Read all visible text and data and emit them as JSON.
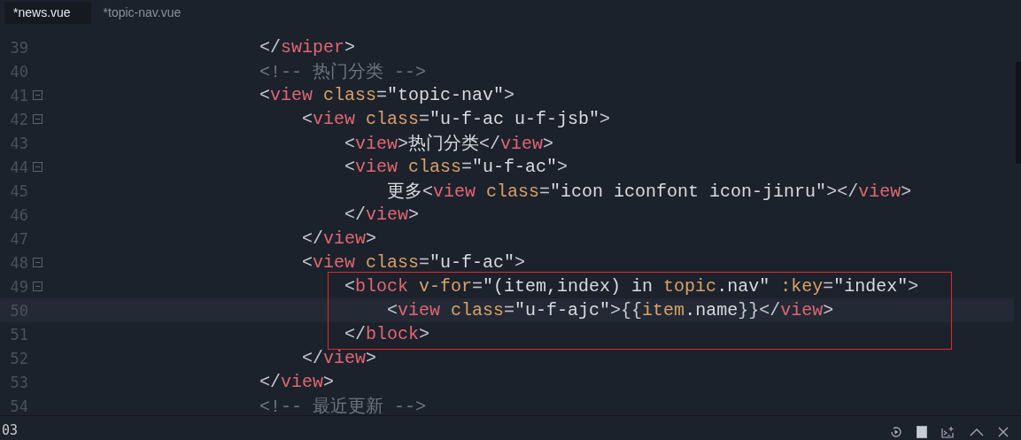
{
  "tabs": [
    {
      "label": "*news.vue",
      "selected": true
    },
    {
      "label": "*topic-nav.vue",
      "selected": false
    }
  ],
  "lines": [
    {
      "number": "39",
      "foldable": false,
      "current": false,
      "marked": false,
      "tokens": [
        {
          "kind": "punct",
          "text": "</"
        },
        {
          "kind": "tag",
          "text": "swiper"
        },
        {
          "kind": "punct",
          "text": ">"
        }
      ]
    },
    {
      "number": "40",
      "foldable": false,
      "current": false,
      "marked": false,
      "tokens": [
        {
          "kind": "comment",
          "text": "<!-- 热门分类 -->"
        }
      ]
    },
    {
      "number": "41",
      "foldable": true,
      "current": false,
      "marked": false,
      "tokens": [
        {
          "kind": "punct",
          "text": "<"
        },
        {
          "kind": "tag",
          "text": "view"
        },
        {
          "kind": "attr",
          "text": " class"
        },
        {
          "kind": "punct",
          "text": "="
        },
        {
          "kind": "string",
          "text": "\"topic-nav\""
        },
        {
          "kind": "punct",
          "text": ">"
        }
      ],
      "children": [
        {
          "number": "42",
          "foldable": true,
          "current": false,
          "marked": false,
          "tokens": [
            {
              "kind": "punct",
              "text": "<"
            },
            {
              "kind": "tag",
              "text": "view"
            },
            {
              "kind": "attr",
              "text": " class"
            },
            {
              "kind": "punct",
              "text": "="
            },
            {
              "kind": "string",
              "text": "\"u-f-ac u-f-jsb\""
            },
            {
              "kind": "punct",
              "text": ">"
            }
          ],
          "children": [
            {
              "number": "43",
              "foldable": false,
              "current": false,
              "marked": false,
              "tokens": [
                {
                  "kind": "punct",
                  "text": "<"
                },
                {
                  "kind": "tag",
                  "text": "view"
                },
                {
                  "kind": "punct",
                  "text": ">"
                },
                {
                  "kind": "text",
                  "text": "热门分类"
                },
                {
                  "kind": "punct",
                  "text": "</"
                },
                {
                  "kind": "tag",
                  "text": "view"
                },
                {
                  "kind": "punct",
                  "text": ">"
                }
              ]
            },
            {
              "number": "44",
              "foldable": true,
              "current": false,
              "marked": false,
              "tokens": [
                {
                  "kind": "punct",
                  "text": "<"
                },
                {
                  "kind": "tag",
                  "text": "view"
                },
                {
                  "kind": "attr",
                  "text": " class"
                },
                {
                  "kind": "punct",
                  "text": "="
                },
                {
                  "kind": "string",
                  "text": "\"u-f-ac\""
                },
                {
                  "kind": "punct",
                  "text": ">"
                }
              ],
              "children": [
                {
                  "number": "45",
                  "foldable": false,
                  "current": false,
                  "marked": false,
                  "tokens": [
                    {
                      "kind": "text",
                      "text": "更多"
                    },
                    {
                      "kind": "punct",
                      "text": "<"
                    },
                    {
                      "kind": "tag",
                      "text": "view"
                    },
                    {
                      "kind": "attr",
                      "text": " class"
                    },
                    {
                      "kind": "punct",
                      "text": "="
                    },
                    {
                      "kind": "string",
                      "text": "\"icon iconfont icon-jinru\""
                    },
                    {
                      "kind": "punct",
                      "text": "></"
                    },
                    {
                      "kind": "tag",
                      "text": "view"
                    },
                    {
                      "kind": "punct",
                      "text": ">"
                    }
                  ]
                }
              ]
            },
            {
              "number": "46",
              "foldable": false,
              "current": false,
              "marked": false,
              "tokens": [
                {
                  "kind": "punct",
                  "text": "</"
                },
                {
                  "kind": "tag",
                  "text": "view"
                },
                {
                  "kind": "punct",
                  "text": ">"
                }
              ]
            }
          ]
        },
        {
          "number": "47",
          "foldable": false,
          "current": false,
          "marked": false,
          "tokens": [
            {
              "kind": "punct",
              "text": "</"
            },
            {
              "kind": "tag",
              "text": "view"
            },
            {
              "kind": "punct",
              "text": ">"
            }
          ]
        },
        {
          "number": "48",
          "foldable": true,
          "current": false,
          "marked": false,
          "tokens": [
            {
              "kind": "punct",
              "text": "<"
            },
            {
              "kind": "tag",
              "text": "view"
            },
            {
              "kind": "attr",
              "text": " class"
            },
            {
              "kind": "punct",
              "text": "="
            },
            {
              "kind": "string",
              "text": "\"u-f-ac\""
            },
            {
              "kind": "punct",
              "text": ">"
            }
          ],
          "children": [
            {
              "number": "49",
              "foldable": true,
              "current": false,
              "marked": true,
              "tokens": [
                {
                  "kind": "punct",
                  "text": "<"
                },
                {
                  "kind": "tag",
                  "text": "block"
                },
                {
                  "kind": "attr",
                  "text": " v-for"
                },
                {
                  "kind": "punct",
                  "text": "="
                },
                {
                  "kind": "string",
                  "text": "\"(item,index) in "
                },
                {
                  "kind": "var",
                  "text": "topic"
                },
                {
                  "kind": "string",
                  "text": ".nav\""
                },
                {
                  "kind": "attr",
                  "text": " :key"
                },
                {
                  "kind": "punct",
                  "text": "="
                },
                {
                  "kind": "string",
                  "text": "\"index\""
                },
                {
                  "kind": "punct",
                  "text": ">"
                }
              ],
              "children": [
                {
                  "number": "50",
                  "foldable": false,
                  "current": true,
                  "marked": true,
                  "tokens": [
                    {
                      "kind": "punct",
                      "text": "<"
                    },
                    {
                      "kind": "tag",
                      "text": "view"
                    },
                    {
                      "kind": "attr",
                      "text": " class"
                    },
                    {
                      "kind": "punct",
                      "text": "="
                    },
                    {
                      "kind": "string",
                      "text": "\"u-f-ajc\""
                    },
                    {
                      "kind": "punct",
                      "text": ">{{"
                    },
                    {
                      "kind": "var",
                      "text": "item"
                    },
                    {
                      "kind": "text",
                      "text": ".name"
                    },
                    {
                      "kind": "punct",
                      "text": "}}</"
                    },
                    {
                      "kind": "tag",
                      "text": "view"
                    },
                    {
                      "kind": "punct",
                      "text": ">"
                    }
                  ]
                }
              ]
            },
            {
              "number": "51",
              "foldable": false,
              "current": false,
              "marked": true,
              "tokens": [
                {
                  "kind": "punct",
                  "text": "</"
                },
                {
                  "kind": "tag",
                  "text": "block"
                },
                {
                  "kind": "punct",
                  "text": ">"
                }
              ]
            }
          ]
        },
        {
          "number": "52",
          "foldable": false,
          "current": false,
          "marked": false,
          "tokens": [
            {
              "kind": "punct",
              "text": "</"
            },
            {
              "kind": "tag",
              "text": "view"
            },
            {
              "kind": "punct",
              "text": ">"
            }
          ]
        }
      ]
    },
    {
      "number": "53",
      "foldable": false,
      "current": false,
      "marked": false,
      "tokens": [
        {
          "kind": "punct",
          "text": "</"
        },
        {
          "kind": "tag",
          "text": "view"
        },
        {
          "kind": "punct",
          "text": ">"
        }
      ]
    },
    {
      "number": "54",
      "foldable": false,
      "current": false,
      "marked": false,
      "tokens": [
        {
          "kind": "comment",
          "text": "<!-- 最近更新 -->"
        }
      ]
    }
  ],
  "panel": {
    "text": "03"
  }
}
